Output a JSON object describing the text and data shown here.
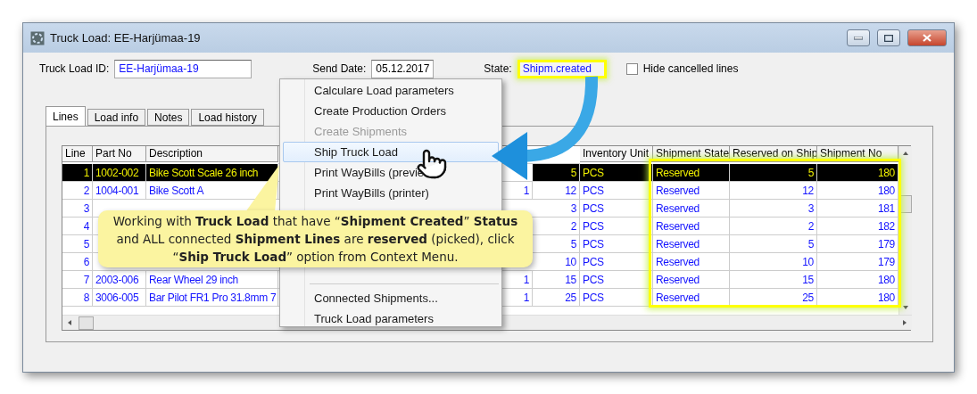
{
  "window": {
    "title": "Truck Load: EE-Harjümaa-19"
  },
  "form": {
    "id_label": "Truck Load ID:",
    "id_value": "EE-Harjümaa-19",
    "date_label": "Send Date:",
    "date_value": "05.12.2017",
    "state_label": "State:",
    "state_value": "Shipm.created",
    "hide_cancelled": {
      "label": "Hide cancelled lines",
      "checked": false
    }
  },
  "tabs": [
    {
      "label": "Lines",
      "selected": true
    },
    {
      "label": "Load info",
      "selected": false
    },
    {
      "label": "Notes",
      "selected": false
    },
    {
      "label": "Load history",
      "selected": false
    }
  ],
  "table": {
    "columns": [
      {
        "label": "Line"
      },
      {
        "label": "Part No"
      },
      {
        "label": "Description"
      },
      {},
      {},
      {},
      {
        "label": "Inventory Unit"
      },
      {
        "label": "Shipment State"
      },
      {
        "label": "Reserved on Ship"
      },
      {
        "label": "Shipment No"
      }
    ],
    "rows": [
      {
        "selected": true,
        "cells": [
          "1",
          "1002-002",
          "Bike Scott Scale 26 inch",
          null,
          null,
          "5",
          "PCS",
          "Reserved",
          "5",
          "180"
        ]
      },
      {
        "selected": false,
        "cells": [
          "2",
          "1004-001",
          "Bike Scott A",
          null,
          "1",
          "12",
          "PCS",
          "Reserved",
          "12",
          "180"
        ]
      },
      {
        "selected": false,
        "cells": [
          "3",
          null,
          null,
          null,
          null,
          "3",
          "PCS",
          "Reserved",
          "3",
          "181"
        ]
      },
      {
        "selected": false,
        "cells": [
          "4",
          null,
          null,
          null,
          null,
          "2",
          "PCS",
          "Reserved",
          "2",
          "182"
        ]
      },
      {
        "selected": false,
        "cells": [
          "5",
          null,
          null,
          null,
          null,
          "5",
          "PCS",
          "Reserved",
          "5",
          "179"
        ]
      },
      {
        "selected": false,
        "cells": [
          "6",
          null,
          null,
          null,
          null,
          "10",
          "PCS",
          "Reserved",
          "10",
          "179"
        ]
      },
      {
        "selected": false,
        "cells": [
          "7",
          "2003-006",
          "Rear Wheel 29 inch",
          null,
          "1",
          "15",
          "PCS",
          "Reserved",
          "15",
          "180"
        ]
      },
      {
        "selected": false,
        "cells": [
          "8",
          "3006-005",
          "Bar Pilot FR1 Pro 31.8mm 7",
          null,
          "1",
          "25",
          "PCS",
          "Reserved",
          "25",
          "180"
        ]
      }
    ]
  },
  "context_menu": {
    "groups": [
      [
        {
          "label": "Calculare Load parameters",
          "disabled": false,
          "selected": false
        },
        {
          "label": "Create Production Orders",
          "disabled": false,
          "selected": false
        },
        {
          "label": "Create Shipments",
          "disabled": true,
          "selected": false
        },
        {
          "label": "Ship Truck Load",
          "disabled": false,
          "selected": true
        },
        {
          "label": "Print WayBills (previe",
          "disabled": false,
          "selected": false
        },
        {
          "label": "Print WayBills (printer)",
          "disabled": false,
          "selected": false
        }
      ],
      [
        {
          "label": "Connected Shipments...",
          "disabled": false,
          "selected": false
        },
        {
          "label": "Truck Load parameters",
          "disabled": false,
          "selected": false
        }
      ]
    ]
  },
  "callout": {
    "text": "Working with **Truck Load** that have “**Shipment Created**” **Status** and ALL connected **Shipment Lines** are **reserved** (picked), click “**Ship Truck Load**” option from Context Menu."
  }
}
